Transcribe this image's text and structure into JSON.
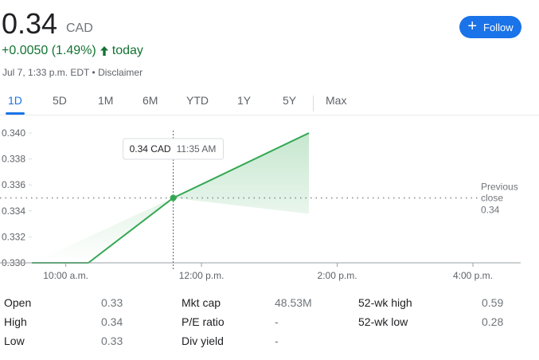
{
  "quote": {
    "price": "0.34",
    "currency": "CAD",
    "change": "+0.0050 (1.49%)",
    "period": "today",
    "timestamp": "Jul 7, 1:33 p.m. EDT",
    "separator": "•",
    "disclaimer": "Disclaimer"
  },
  "follow": {
    "label": "Follow",
    "icon": "plus-icon"
  },
  "tabs": [
    "1D",
    "5D",
    "1M",
    "6M",
    "YTD",
    "1Y",
    "5Y",
    "Max"
  ],
  "active_tab": "1D",
  "colors": {
    "accent": "#1a73e8",
    "positive": "#137333",
    "line": "#34a853"
  },
  "chart_data": {
    "type": "area",
    "y_ticks": [
      "0.340",
      "0.338",
      "0.336",
      "0.334",
      "0.332",
      "0.330"
    ],
    "x_ticks": [
      "10:00 a.m.",
      "12:00 p.m.",
      "2:00 p.m.",
      "4:00 p.m."
    ],
    "ylim": [
      0.33,
      0.34
    ],
    "x_unit": "minutes after 9:30 a.m.",
    "xlim": [
      0,
      390
    ],
    "x_tick_values": [
      30,
      150,
      270,
      390
    ],
    "points": [
      [
        0,
        0.33
      ],
      [
        50,
        0.33
      ],
      [
        125,
        0.335
      ],
      [
        245,
        0.34
      ]
    ],
    "previous_close": {
      "label_line1": "Previous",
      "label_line2": "close",
      "value": "0.34",
      "y": 0.335
    },
    "tooltip": {
      "value": "0.34 CAD",
      "time": "11:35 AM",
      "x": 125,
      "y": 0.335
    }
  },
  "stats": {
    "col1": [
      {
        "label": "Open",
        "value": "0.33"
      },
      {
        "label": "High",
        "value": "0.34"
      },
      {
        "label": "Low",
        "value": "0.33"
      }
    ],
    "col2": [
      {
        "label": "Mkt cap",
        "value": "48.53M"
      },
      {
        "label": "P/E ratio",
        "value": "-"
      },
      {
        "label": "Div yield",
        "value": "-"
      }
    ],
    "col3": [
      {
        "label": "52-wk high",
        "value": "0.59"
      },
      {
        "label": "52-wk low",
        "value": "0.28"
      }
    ]
  }
}
